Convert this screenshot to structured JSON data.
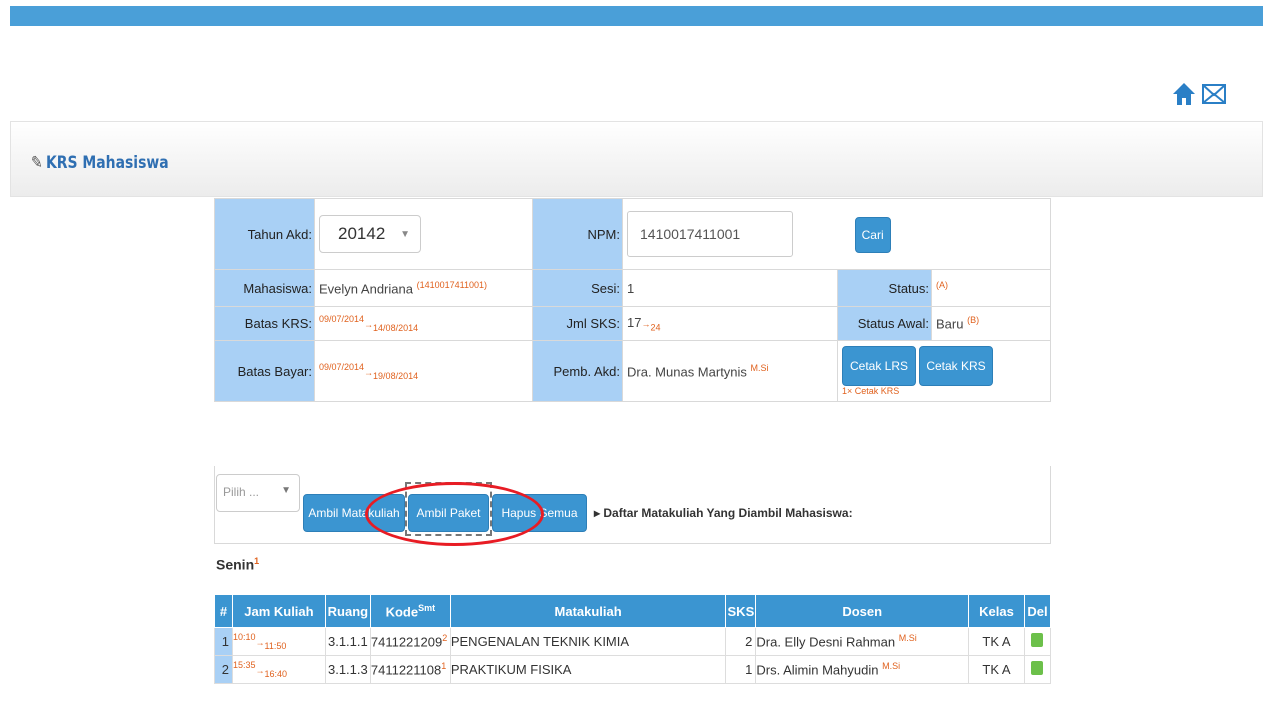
{
  "header": {
    "title": "KRS Mahasiswa"
  },
  "form": {
    "tahun_akd_label": "Tahun Akd:",
    "tahun_akd_value": "20142",
    "npm_label": "NPM:",
    "npm_value": "1410017411001",
    "cari_label": "Cari",
    "mahasiswa_label": "Mahasiswa:",
    "mahasiswa_name": "Evelyn Andriana",
    "mahasiswa_npm": "(1410017411001)",
    "sesi_label": "Sesi:",
    "sesi_value": "1",
    "status_label": "Status:",
    "status_value": "(A)",
    "batas_krs_label": "Batas KRS:",
    "batas_krs_start": "09/07/2014",
    "batas_krs_end": "14/08/2014",
    "jml_sks_label": "Jml SKS:",
    "jml_sks_value": "17",
    "jml_sks_max": "24",
    "status_awal_label": "Status Awal:",
    "status_awal_value": "Baru",
    "status_awal_code": "(B)",
    "batas_bayar_label": "Batas Bayar:",
    "batas_bayar_start": "09/07/2014",
    "batas_bayar_end": "19/08/2014",
    "pemb_akd_label": "Pemb. Akd:",
    "pemb_akd_value": "Dra. Munas Martynis",
    "pemb_akd_title": "M.Si",
    "cetak_lrs_label": "Cetak LRS",
    "cetak_krs_label": "Cetak KRS",
    "cetak_count": "1× Cetak KRS"
  },
  "actions": {
    "pilih_placeholder": "Pilih ...",
    "ambil_matakuliah": "Ambil Matakuliah",
    "ambil_paket": "Ambil Paket",
    "hapus_semua": "Hapus Semua",
    "daftar_title": "Daftar Matakuliah Yang Diambil Mahasiswa:"
  },
  "day": {
    "label": "Senin",
    "sup": "1"
  },
  "table": {
    "headers": [
      "#",
      "Jam Kuliah",
      "Ruang",
      "Kode",
      "Matakuliah",
      "SKS",
      "Dosen",
      "Kelas",
      "Del"
    ],
    "kode_sup": "Smt",
    "rows": [
      {
        "no": "1",
        "jam_start": "10:10",
        "jam_end": "11:50",
        "ruang": "3.1.1.1",
        "kode": "7411221209",
        "kode_sup": "2",
        "matakuliah": "PENGENALAN TEKNIK KIMIA",
        "sks": "2",
        "dosen": "Dra. Elly Desni Rahman",
        "dosen_title": "M.Si",
        "kelas": "TK A"
      },
      {
        "no": "2",
        "jam_start": "15:35",
        "jam_end": "16:40",
        "ruang": "3.1.1.3",
        "kode": "7411221108",
        "kode_sup": "1",
        "matakuliah": "PRAKTIKUM FISIKA",
        "sks": "1",
        "dosen": "Drs. Alimin Mahyudin",
        "dosen_title": "M.Si",
        "kelas": "TK A"
      }
    ]
  },
  "colors": {
    "topbar": "#4a9fd8",
    "label_bg": "#a9d0f5",
    "button": "#3b95d1",
    "highlight": "#e81c24",
    "accent_red": "#e0621f"
  },
  "icons": [
    "home-icon",
    "mail-icon",
    "edit-icon",
    "caret-down-icon",
    "arrow-right-icon",
    "delete-icon"
  ]
}
